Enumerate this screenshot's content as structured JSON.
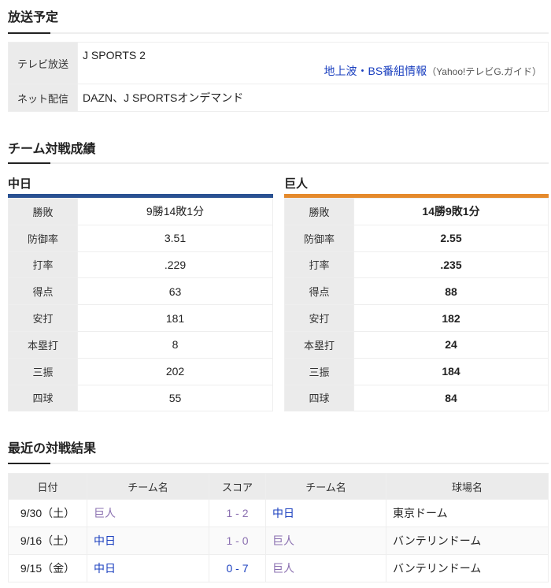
{
  "broadcast": {
    "title": "放送予定",
    "rows": [
      {
        "label": "テレビ放送",
        "value": "J SPORTS 2",
        "link": "地上波・BS番組情報",
        "note": "（Yahoo!テレビG.ガイド）"
      },
      {
        "label": "ネット配信",
        "value": "DAZN、J SPORTSオンデマンド"
      }
    ]
  },
  "stats": {
    "title": "チーム対戦成績",
    "left": {
      "team": "中日",
      "color": "#2a5192",
      "rows": [
        [
          "勝敗",
          "9勝14敗1分"
        ],
        [
          "防御率",
          "3.51"
        ],
        [
          "打率",
          ".229"
        ],
        [
          "得点",
          "63"
        ],
        [
          "安打",
          "181"
        ],
        [
          "本塁打",
          "8"
        ],
        [
          "三振",
          "202"
        ],
        [
          "四球",
          "55"
        ]
      ]
    },
    "right": {
      "team": "巨人",
      "color": "#e58a2c",
      "rows": [
        [
          "勝敗",
          "14勝9敗1分"
        ],
        [
          "防御率",
          "2.55"
        ],
        [
          "打率",
          ".235"
        ],
        [
          "得点",
          "88"
        ],
        [
          "安打",
          "182"
        ],
        [
          "本塁打",
          "24"
        ],
        [
          "三振",
          "184"
        ],
        [
          "四球",
          "84"
        ]
      ]
    }
  },
  "results": {
    "title": "最近の対戦結果",
    "headers": [
      "日付",
      "チーム名",
      "スコア",
      "チーム名",
      "球場名"
    ],
    "rows": [
      {
        "date": "9/30（土）",
        "home": "巨人",
        "home_c": "purple",
        "score": "1 - 2",
        "score_c": "purple",
        "away": "中日",
        "away_c": "blue",
        "stadium": "東京ドーム"
      },
      {
        "date": "9/16（土）",
        "home": "中日",
        "home_c": "blue",
        "score": "1 - 0",
        "score_c": "purple",
        "away": "巨人",
        "away_c": "purple",
        "stadium": "バンテリンドーム"
      },
      {
        "date": "9/15（金）",
        "home": "中日",
        "home_c": "blue",
        "score": "0 - 7",
        "score_c": "blue",
        "away": "巨人",
        "away_c": "purple",
        "stadium": "バンテリンドーム"
      }
    ]
  }
}
